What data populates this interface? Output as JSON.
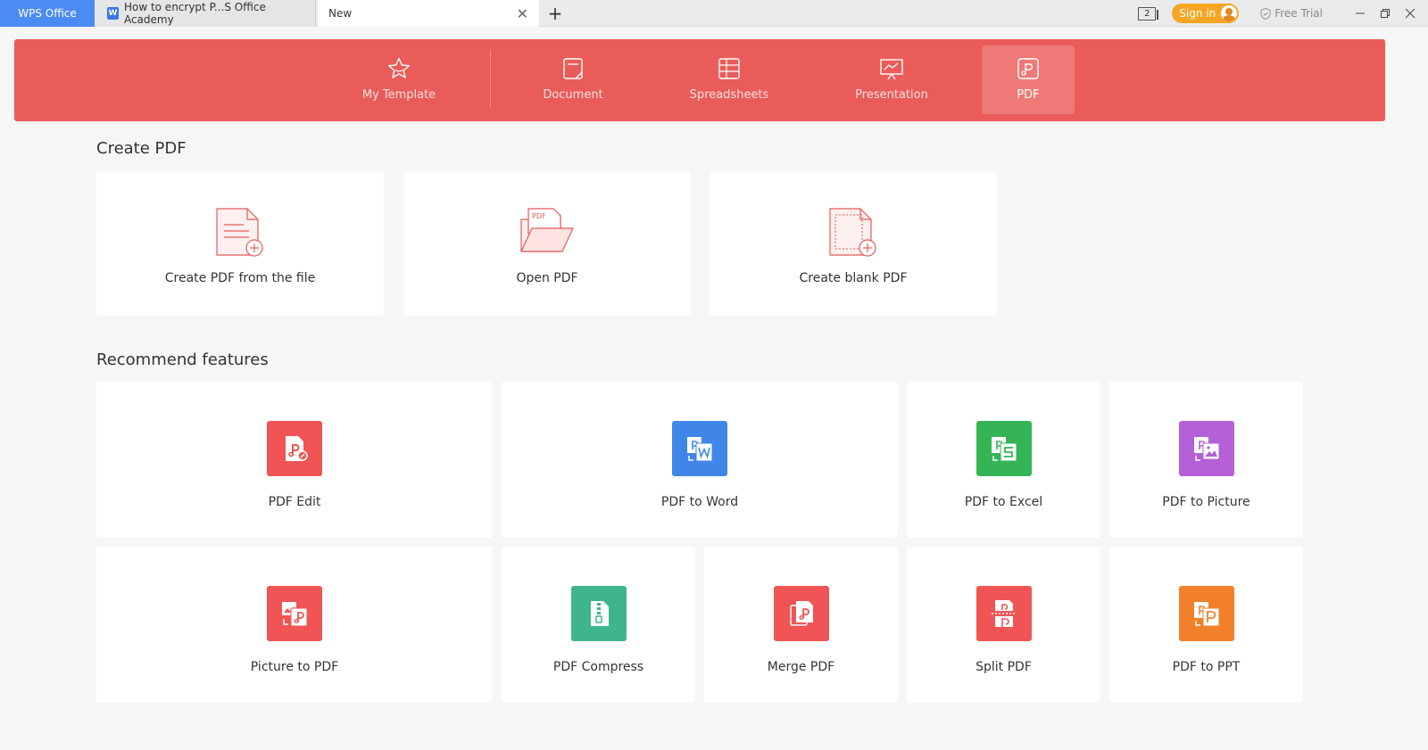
{
  "tabs": {
    "app": "WPS Office",
    "academy": "How to encrypt P...S Office Academy",
    "new": "New",
    "window_count": "2"
  },
  "titlebar": {
    "sign_in": "Sign in",
    "free_trial": "Free Trial"
  },
  "categories": [
    {
      "label": "My Template",
      "icon": "star-icon"
    },
    {
      "label": "Document",
      "icon": "document-icon"
    },
    {
      "label": "Spreadsheets",
      "icon": "spreadsheet-icon"
    },
    {
      "label": "Presentation",
      "icon": "presentation-icon"
    },
    {
      "label": "PDF",
      "icon": "pdf-icon",
      "active": true
    }
  ],
  "create_section": {
    "title": "Create PDF",
    "cards": [
      {
        "label": "Create PDF from the file",
        "icon": "file-add-icon"
      },
      {
        "label": "Open PDF",
        "icon": "open-folder-icon",
        "icon_text": "PDF"
      },
      {
        "label": "Create blank PDF",
        "icon": "blank-file-add-icon"
      }
    ]
  },
  "features_section": {
    "title": "Recommend features",
    "cards": [
      {
        "label": "PDF Edit",
        "color": "#f05454"
      },
      {
        "label": "PDF to Word",
        "color": "#3f86e8"
      },
      {
        "label": "PDF to Excel",
        "color": "#35b455"
      },
      {
        "label": "PDF to Picture",
        "color": "#b55fd9"
      },
      {
        "label": "Picture to PDF",
        "color": "#f05454"
      },
      {
        "label": "PDF Compress",
        "color": "#3fb58b"
      },
      {
        "label": "Merge PDF",
        "color": "#f05454"
      },
      {
        "label": "Split PDF",
        "color": "#f05454"
      },
      {
        "label": "PDF to PPT",
        "color": "#f2802a"
      }
    ]
  }
}
